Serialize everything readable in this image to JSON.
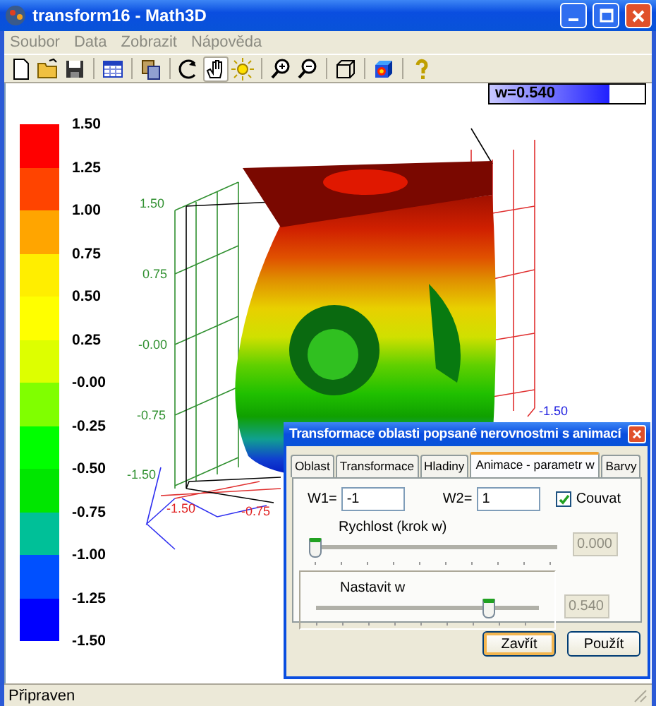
{
  "window": {
    "title": "transform16 - Math3D"
  },
  "menu": [
    "Soubor",
    "Data",
    "Zobrazit",
    "Nápověda"
  ],
  "toolbar": [
    {
      "kind": "new",
      "selected": false
    },
    {
      "kind": "open",
      "selected": false
    },
    {
      "kind": "save",
      "selected": false
    },
    {
      "kind": "separator"
    },
    {
      "kind": "table",
      "selected": false
    },
    {
      "kind": "separator"
    },
    {
      "kind": "copy",
      "selected": false
    },
    {
      "kind": "separator"
    },
    {
      "kind": "rotate",
      "selected": false
    },
    {
      "kind": "hand",
      "selected": true
    },
    {
      "kind": "light",
      "selected": false
    },
    {
      "kind": "separator"
    },
    {
      "kind": "zoom-in",
      "selected": false
    },
    {
      "kind": "zoom-out",
      "selected": false
    },
    {
      "kind": "separator"
    },
    {
      "kind": "cube",
      "selected": false
    },
    {
      "kind": "separator"
    },
    {
      "kind": "color-cube",
      "selected": false
    },
    {
      "kind": "separator"
    },
    {
      "kind": "help",
      "selected": false
    }
  ],
  "parameter_indicator": {
    "label": "w=0.540",
    "level": 0.77
  },
  "legend": {
    "bands": [
      {
        "color": "#ff0000"
      },
      {
        "color": "#ff4400"
      },
      {
        "color": "#ffa500"
      },
      {
        "color": "#ffee00"
      },
      {
        "color": "#ffff00"
      },
      {
        "color": "#ddff00"
      },
      {
        "color": "#80ff00"
      },
      {
        "color": "#00ff00"
      },
      {
        "color": "#00e600"
      },
      {
        "color": "#00c098"
      },
      {
        "color": "#0050ff"
      },
      {
        "color": "#0000ff"
      }
    ],
    "labels": [
      "1.50",
      "1.25",
      "1.00",
      "0.75",
      "0.50",
      "0.25",
      "-0.00",
      "-0.25",
      "-0.50",
      "-0.75",
      "-1.00",
      "-1.25",
      "-1.50"
    ]
  },
  "scene": {
    "axis_labels": [
      {
        "text": "1.50",
        "color": "#309030"
      },
      {
        "text": "0.75",
        "color": "#309030"
      },
      {
        "text": "-0.00",
        "color": "#309030"
      },
      {
        "text": "-0.75",
        "color": "#309030"
      },
      {
        "text": "-1.50",
        "color": "#309030"
      },
      {
        "text": "-1.50",
        "color": "#e02020"
      },
      {
        "text": "-0.75",
        "color": "#e02020"
      },
      {
        "text": "-1.50",
        "color": "#2020e0"
      }
    ]
  },
  "dialog": {
    "title": "Transformace oblasti popsané nerovnostmi s animací",
    "tabs": [
      {
        "label": "Oblast",
        "selected": false
      },
      {
        "label": "Transformace",
        "selected": false
      },
      {
        "label": "Hladiny",
        "selected": false
      },
      {
        "label": "Animace - parametr w",
        "selected": true
      },
      {
        "label": "Barvy",
        "selected": false
      }
    ],
    "w1": {
      "label": "W1=",
      "value": "-1"
    },
    "w2": {
      "label": "W2=",
      "value": "1"
    },
    "reverse": {
      "label": "Couvat",
      "checked": true
    },
    "sliders": [
      {
        "label": "Rychlost (krok w)",
        "level": 0,
        "value": "0.000",
        "disabled": true,
        "framed": false
      },
      {
        "label": "Nastavit w",
        "level": 0.77,
        "value": "0.540",
        "disabled": true,
        "framed": true
      }
    ],
    "buttons": [
      {
        "label": "Zavřít",
        "focused": true
      },
      {
        "label": "Použít",
        "focused": false
      }
    ]
  },
  "status_bar": {
    "text": "Připraven"
  }
}
